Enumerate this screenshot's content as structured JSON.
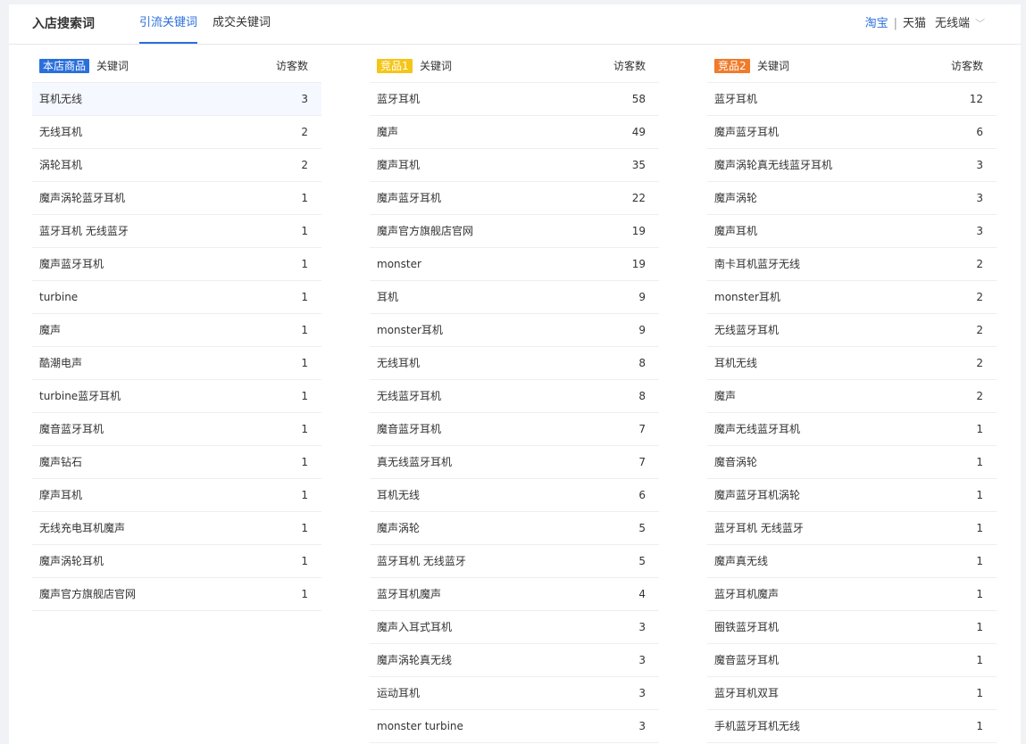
{
  "header": {
    "title": "入店搜索词",
    "tabs": [
      "引流关键词",
      "成交关键词"
    ],
    "platforms": [
      "淘宝",
      "天猫"
    ],
    "device": "无线端"
  },
  "columns": [
    {
      "tag": "本店商品",
      "tag_color": "#2a6fdb",
      "keyword_header": "关键词",
      "count_header": "访客数",
      "rows": [
        {
          "kw": "耳机无线",
          "n": "3"
        },
        {
          "kw": "无线耳机",
          "n": "2"
        },
        {
          "kw": "涡轮耳机",
          "n": "2"
        },
        {
          "kw": "魔声涡轮蓝牙耳机",
          "n": "1"
        },
        {
          "kw": "蓝牙耳机 无线蓝牙",
          "n": "1"
        },
        {
          "kw": "魔声蓝牙耳机",
          "n": "1"
        },
        {
          "kw": "turbine",
          "n": "1"
        },
        {
          "kw": "魔声",
          "n": "1"
        },
        {
          "kw": "酷潮电声",
          "n": "1"
        },
        {
          "kw": "turbine蓝牙耳机",
          "n": "1"
        },
        {
          "kw": "魔音蓝牙耳机",
          "n": "1"
        },
        {
          "kw": "魔声钻石",
          "n": "1"
        },
        {
          "kw": "摩声耳机",
          "n": "1"
        },
        {
          "kw": "无线充电耳机魔声",
          "n": "1"
        },
        {
          "kw": "魔声涡轮耳机",
          "n": "1"
        },
        {
          "kw": "魔声官方旗舰店官网",
          "n": "1"
        }
      ]
    },
    {
      "tag": "竞品1",
      "tag_color": "#f5c518",
      "keyword_header": "关键词",
      "count_header": "访客数",
      "rows": [
        {
          "kw": "蓝牙耳机",
          "n": "58"
        },
        {
          "kw": "魔声",
          "n": "49"
        },
        {
          "kw": "魔声耳机",
          "n": "35"
        },
        {
          "kw": "魔声蓝牙耳机",
          "n": "22"
        },
        {
          "kw": "魔声官方旗舰店官网",
          "n": "19"
        },
        {
          "kw": "monster",
          "n": "19"
        },
        {
          "kw": "耳机",
          "n": "9"
        },
        {
          "kw": "monster耳机",
          "n": "9"
        },
        {
          "kw": "无线耳机",
          "n": "8"
        },
        {
          "kw": "无线蓝牙耳机",
          "n": "8"
        },
        {
          "kw": "魔音蓝牙耳机",
          "n": "7"
        },
        {
          "kw": "真无线蓝牙耳机",
          "n": "7"
        },
        {
          "kw": "耳机无线",
          "n": "6"
        },
        {
          "kw": "魔声涡轮",
          "n": "5"
        },
        {
          "kw": "蓝牙耳机 无线蓝牙",
          "n": "5"
        },
        {
          "kw": "蓝牙耳机魔声",
          "n": "4"
        },
        {
          "kw": "魔声入耳式耳机",
          "n": "3"
        },
        {
          "kw": "魔声涡轮真无线",
          "n": "3"
        },
        {
          "kw": "运动耳机",
          "n": "3"
        },
        {
          "kw": "monster turbine",
          "n": "3"
        }
      ]
    },
    {
      "tag": "竞品2",
      "tag_color": "#f07b2a",
      "keyword_header": "关键词",
      "count_header": "访客数",
      "rows": [
        {
          "kw": "蓝牙耳机",
          "n": "12"
        },
        {
          "kw": "魔声蓝牙耳机",
          "n": "6"
        },
        {
          "kw": "魔声涡轮真无线蓝牙耳机",
          "n": "3"
        },
        {
          "kw": "魔声涡轮",
          "n": "3"
        },
        {
          "kw": "魔声耳机",
          "n": "3"
        },
        {
          "kw": "南卡耳机蓝牙无线",
          "n": "2"
        },
        {
          "kw": "monster耳机",
          "n": "2"
        },
        {
          "kw": "无线蓝牙耳机",
          "n": "2"
        },
        {
          "kw": "耳机无线",
          "n": "2"
        },
        {
          "kw": "魔声",
          "n": "2"
        },
        {
          "kw": "魔声无线蓝牙耳机",
          "n": "1"
        },
        {
          "kw": "魔音涡轮",
          "n": "1"
        },
        {
          "kw": "魔声蓝牙耳机涡轮",
          "n": "1"
        },
        {
          "kw": "蓝牙耳机 无线蓝牙",
          "n": "1"
        },
        {
          "kw": "魔声真无线",
          "n": "1"
        },
        {
          "kw": "蓝牙耳机魔声",
          "n": "1"
        },
        {
          "kw": "圈铁蓝牙耳机",
          "n": "1"
        },
        {
          "kw": "魔音蓝牙耳机",
          "n": "1"
        },
        {
          "kw": "蓝牙耳机双耳",
          "n": "1"
        },
        {
          "kw": "手机蓝牙耳机无线",
          "n": "1"
        }
      ]
    }
  ]
}
